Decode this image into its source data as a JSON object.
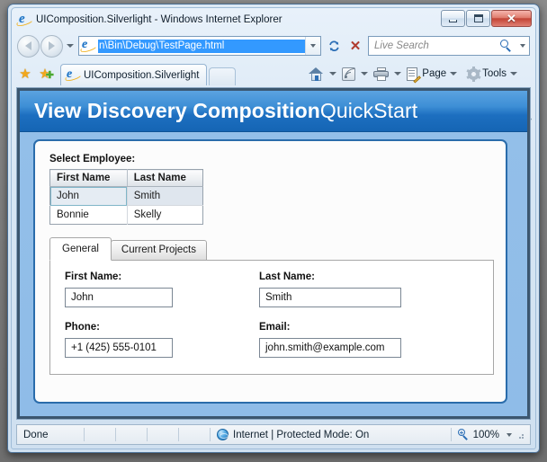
{
  "window": {
    "title": "UIComposition.Silverlight - Windows Internet Explorer",
    "minimize_tooltip": "Minimize",
    "maximize_tooltip": "Maximize",
    "close_glyph": "✕"
  },
  "navbar": {
    "back_tooltip": "Back",
    "forward_tooltip": "Forward",
    "address_value": "n\\Bin\\Debug\\TestPage.html",
    "refresh_tooltip": "Refresh",
    "stop_glyph": "✕",
    "search_placeholder": "Live Search"
  },
  "tabbar": {
    "favorites_star": "★",
    "add_favorite_star": "★",
    "add_favorite_plus": "✚",
    "tab_label": "UIComposition.Silverlight",
    "page_menu": "Page",
    "tools_menu": "Tools",
    "overflow_glyph": "»"
  },
  "app": {
    "title_bold": "View Discovery Composition",
    "title_light": "QuickStart",
    "select_employee_label": "Select Employee:",
    "grid": {
      "columns": [
        "First Name",
        "Last Name"
      ],
      "rows": [
        {
          "first": "John",
          "last": "Smith",
          "selected": true
        },
        {
          "first": "Bonnie",
          "last": "Skelly",
          "selected": false
        }
      ]
    },
    "tabs": [
      {
        "label": "General",
        "active": true
      },
      {
        "label": "Current Projects",
        "active": false
      }
    ],
    "form": {
      "first_name_label": "First Name:",
      "first_name_value": "John",
      "last_name_label": "Last Name:",
      "last_name_value": "Smith",
      "phone_label": "Phone:",
      "phone_value": "+1 (425) 555-0101",
      "email_label": "Email:",
      "email_value": "john.smith@example.com"
    }
  },
  "statusbar": {
    "status": "Done",
    "zone": "Internet | Protected Mode: On",
    "zoom": "100%"
  }
}
